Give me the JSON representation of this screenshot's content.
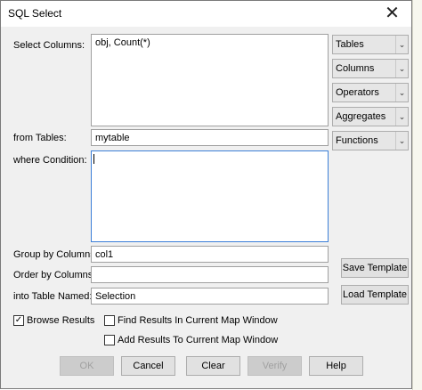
{
  "window": {
    "title": "SQL Select",
    "close_glyph": "✕"
  },
  "labels": {
    "select_columns": "Select Columns:",
    "from_tables": "from Tables:",
    "where_condition": "where Condition:",
    "group_by": "Group by Columns:",
    "order_by": "Order by Columns:",
    "into_table": "into Table Named:"
  },
  "fields": {
    "select_columns": "obj, Count(*)",
    "from_tables": "mytable",
    "where_condition": "",
    "group_by": "col1",
    "order_by": "",
    "into_table": "Selection"
  },
  "dropdowns": {
    "tables": "Tables",
    "columns": "Columns",
    "operators": "Operators",
    "aggregates": "Aggregates",
    "functions": "Functions"
  },
  "template_buttons": {
    "save": "Save Template",
    "load": "Load Template"
  },
  "options": {
    "browse_results": {
      "label": "Browse Results",
      "checked": true,
      "mark": "✓"
    },
    "find_results": {
      "label": "Find Results In Current Map Window",
      "checked": false
    },
    "add_results": {
      "label": "Add Results To Current Map Window",
      "checked": false
    }
  },
  "buttons": {
    "ok": "OK",
    "cancel": "Cancel",
    "clear": "Clear",
    "verify": "Verify",
    "help": "Help"
  },
  "icons": {
    "dropdown_arrow": "chevron-down-icon",
    "dropdown_glyph": "⌄"
  }
}
